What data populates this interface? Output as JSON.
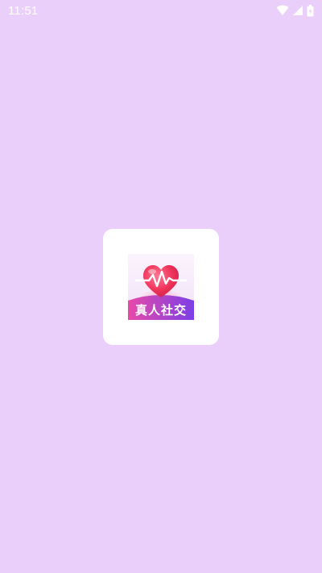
{
  "status_bar": {
    "time": "11:51",
    "icons": [
      "wifi-icon",
      "cellular-signal-icon",
      "battery-icon"
    ]
  },
  "splash": {
    "app_name": "真人社交",
    "logo_icon": "heart-pulse-icon",
    "background_color": "#eacffa",
    "card_color": "#ffffff",
    "brand_gradient": [
      "#e84aa8",
      "#7c3fe6"
    ],
    "heart_color": "#f0345a"
  }
}
